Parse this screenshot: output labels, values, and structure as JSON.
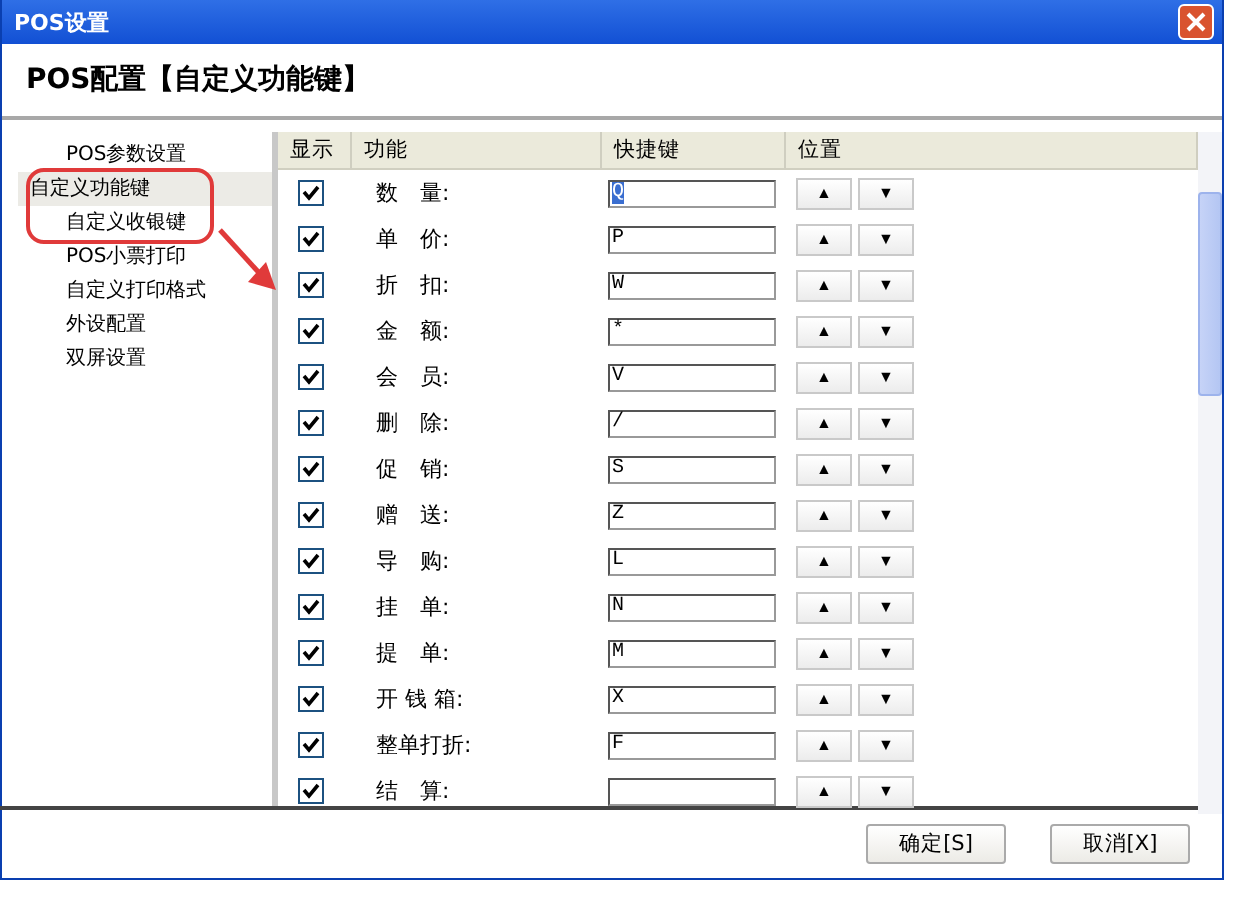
{
  "window": {
    "title": "POS设置"
  },
  "header": {
    "title": "POS配置【自定义功能键】"
  },
  "sidebar": {
    "items": [
      {
        "label": "POS参数设置",
        "selected": false
      },
      {
        "label": "自定义功能键",
        "selected": true
      },
      {
        "label": "自定义收银键",
        "selected": false
      },
      {
        "label": "POS小票打印",
        "selected": false
      },
      {
        "label": "自定义打印格式",
        "selected": false
      },
      {
        "label": "外设配置",
        "selected": false
      },
      {
        "label": "双屏设置",
        "selected": false
      }
    ]
  },
  "table": {
    "columns": [
      "显示",
      "功能",
      "快捷键",
      "位置"
    ],
    "rows": [
      {
        "checked": true,
        "function": "数　量:",
        "shortcut": "Q",
        "selected": true,
        "up": "▲",
        "down": "▼"
      },
      {
        "checked": true,
        "function": "单　价:",
        "shortcut": "P",
        "selected": false,
        "up": "▲",
        "down": "▼"
      },
      {
        "checked": true,
        "function": "折　扣:",
        "shortcut": "W",
        "selected": false,
        "up": "▲",
        "down": "▼"
      },
      {
        "checked": true,
        "function": "金　额:",
        "shortcut": "*",
        "selected": false,
        "up": "▲",
        "down": "▼"
      },
      {
        "checked": true,
        "function": "会　员:",
        "shortcut": "V",
        "selected": false,
        "up": "▲",
        "down": "▼"
      },
      {
        "checked": true,
        "function": "删　除:",
        "shortcut": "/",
        "selected": false,
        "up": "▲",
        "down": "▼"
      },
      {
        "checked": true,
        "function": "促　销:",
        "shortcut": "S",
        "selected": false,
        "up": "▲",
        "down": "▼"
      },
      {
        "checked": true,
        "function": "赠　送:",
        "shortcut": "Z",
        "selected": false,
        "up": "▲",
        "down": "▼"
      },
      {
        "checked": true,
        "function": "导　购:",
        "shortcut": "L",
        "selected": false,
        "up": "▲",
        "down": "▼"
      },
      {
        "checked": true,
        "function": "挂　单:",
        "shortcut": "N",
        "selected": false,
        "up": "▲",
        "down": "▼"
      },
      {
        "checked": true,
        "function": "提　单:",
        "shortcut": "M",
        "selected": false,
        "up": "▲",
        "down": "▼"
      },
      {
        "checked": true,
        "function": "开 钱 箱:",
        "shortcut": "X",
        "selected": false,
        "up": "▲",
        "down": "▼"
      },
      {
        "checked": true,
        "function": "整单打折:",
        "shortcut": "F",
        "selected": false,
        "up": "▲",
        "down": "▼"
      },
      {
        "checked": true,
        "function": "结　算:",
        "up": "▲",
        "down": "▼"
      }
    ]
  },
  "buttons": [
    "确定[S]",
    "取消[X]"
  ]
}
